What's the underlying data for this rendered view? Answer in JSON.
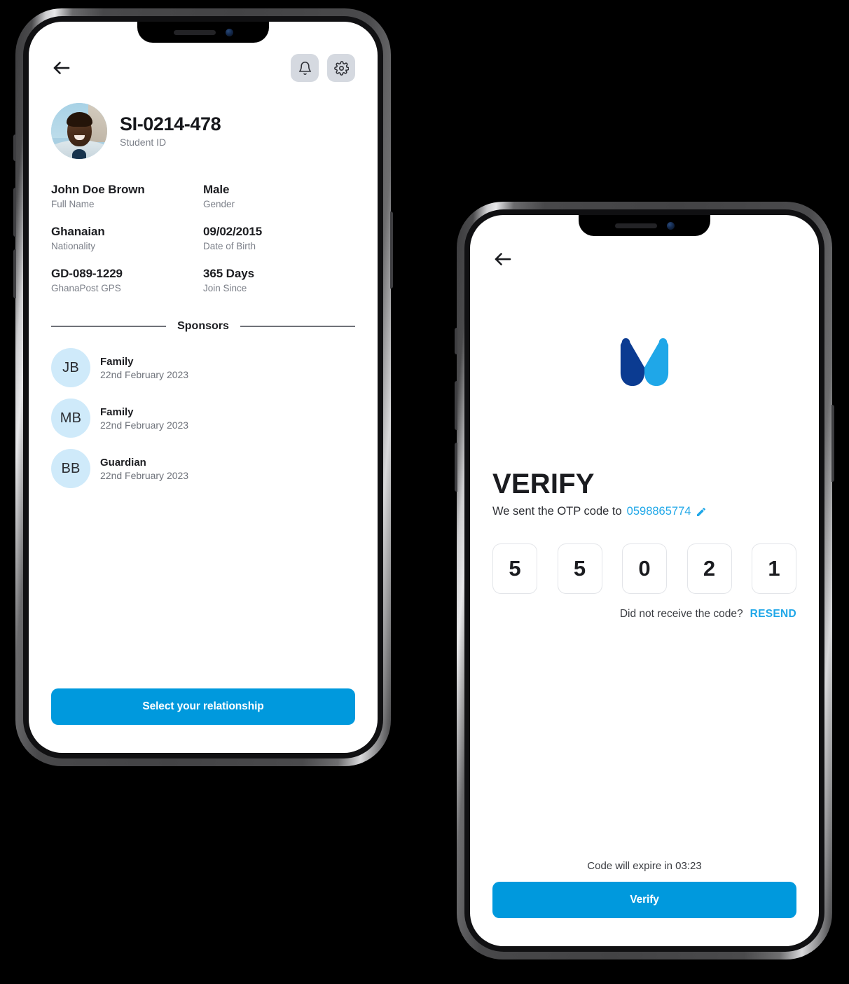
{
  "phone_profile": {
    "topbar": {
      "back_icon": "arrow-left-icon",
      "notifications_icon": "bell-icon",
      "settings_icon": "gear-icon"
    },
    "header": {
      "student_id": "SI-0214-478",
      "student_id_label": "Student ID",
      "avatar_alt": "student-photo"
    },
    "info": [
      {
        "value": "John Doe Brown",
        "label": "Full Name"
      },
      {
        "value": "Male",
        "label": "Gender"
      },
      {
        "value": "Ghanaian",
        "label": "Nationality"
      },
      {
        "value": "09/02/2015",
        "label": "Date of Birth"
      },
      {
        "value": "GD-089-1229",
        "label": "GhanaPost GPS"
      },
      {
        "value": "365 Days",
        "label": "Join Since"
      }
    ],
    "sponsors_section_title": "Sponsors",
    "sponsors": [
      {
        "initials": "JB",
        "relationship": "Family",
        "date": "22nd February 2023"
      },
      {
        "initials": "MB",
        "relationship": "Family",
        "date": "22nd February 2023"
      },
      {
        "initials": "BB",
        "relationship": "Guardian",
        "date": "22nd February 2023"
      }
    ],
    "cta_label": "Select your relationship"
  },
  "phone_verify": {
    "topbar": {
      "back_icon": "arrow-left-icon"
    },
    "logo": {
      "name": "butterfly-logo",
      "color_left": "#0b3b91",
      "color_right": "#1fa7e8"
    },
    "title": "VERIFY",
    "subtitle_prefix": "We sent the OTP code to",
    "phone_number": "0598865774",
    "edit_icon": "pencil-icon",
    "otp_digits": [
      "5",
      "5",
      "0",
      "2",
      "1"
    ],
    "resend_question": "Did not receive the code?",
    "resend_label": "RESEND",
    "expire_text": "Code will expire in 03:23",
    "cta_label": "Verify"
  },
  "theme": {
    "accent": "#0099dd",
    "link": "#1fa7e8",
    "avatar_bg": "#cfeafa",
    "icon_btn_bg": "#d5d9e0"
  }
}
